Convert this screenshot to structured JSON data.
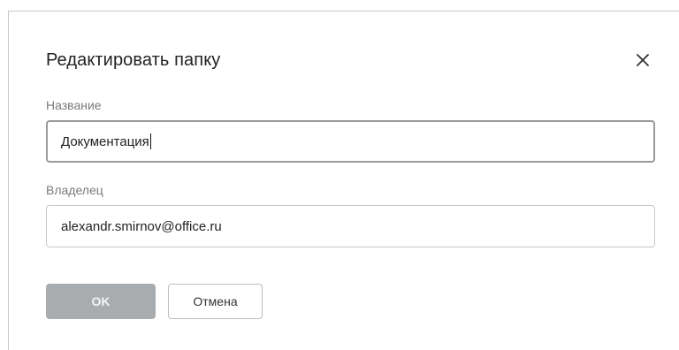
{
  "dialog": {
    "title": "Редактировать папку",
    "close_icon": "close-icon"
  },
  "form": {
    "name_label": "Название",
    "name_value": "Документация",
    "owner_label": "Владелец",
    "owner_value": "alexandr.smirnov@office.ru"
  },
  "actions": {
    "ok_label": "OK",
    "cancel_label": "Отмена"
  },
  "colors": {
    "ok_button_bg": "#a9acae",
    "focused_border": "#9a9a9a",
    "field_border": "#c8c8c8"
  }
}
